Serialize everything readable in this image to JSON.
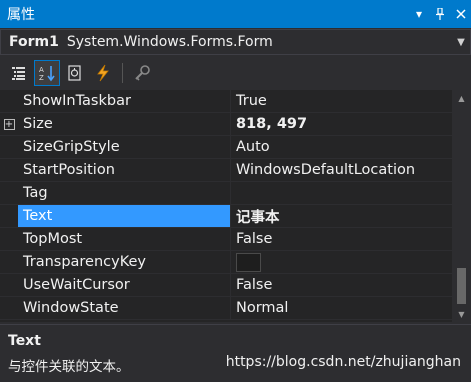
{
  "window": {
    "title": "属性"
  },
  "object": {
    "name": "Form1",
    "type": "System.Windows.Forms.Form"
  },
  "icons": {
    "dropdown": "chevron-down-icon",
    "pin": "pin-icon",
    "close": "close-icon",
    "categorized": "categorized-icon",
    "alphabetical": "alphabetical-icon",
    "properties": "properties-icon",
    "events": "events-icon",
    "property_pages": "property-pages-icon"
  },
  "properties": [
    {
      "name": "ShowInTaskbar",
      "value": "True"
    },
    {
      "name": "Size",
      "value": "818, 497",
      "bold": true,
      "expandable": true
    },
    {
      "name": "SizeGripStyle",
      "value": "Auto"
    },
    {
      "name": "StartPosition",
      "value": "WindowsDefaultLocation"
    },
    {
      "name": "Tag",
      "value": ""
    },
    {
      "name": "Text",
      "value": "记事本",
      "bold": true,
      "selected": true
    },
    {
      "name": "TopMost",
      "value": "False"
    },
    {
      "name": "TransparencyKey",
      "value": "",
      "swatch": true
    },
    {
      "name": "UseWaitCursor",
      "value": "False"
    },
    {
      "name": "WindowState",
      "value": "Normal"
    }
  ],
  "description": {
    "title": "Text",
    "text": "与控件关联的文本。"
  },
  "watermark": "https://blog.csdn.net/zhujianghan",
  "colors": {
    "accent": "#007acc",
    "selection": "#3399ff",
    "background": "#252526"
  }
}
